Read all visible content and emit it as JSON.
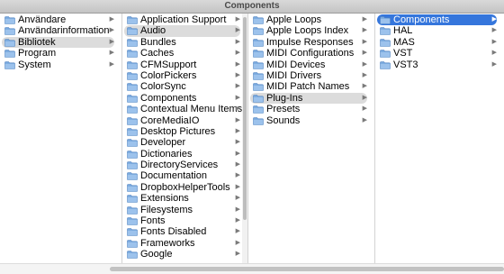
{
  "window": {
    "title": "Components"
  },
  "columns": [
    {
      "items": [
        {
          "label": "Användare",
          "selected": false
        },
        {
          "label": "Användarinformation",
          "selected": false
        },
        {
          "label": "Bibliotek",
          "selected": true
        },
        {
          "label": "Program",
          "selected": false
        },
        {
          "label": "System",
          "selected": false
        }
      ]
    },
    {
      "items": [
        {
          "label": "Application Support",
          "selected": false
        },
        {
          "label": "Audio",
          "selected": true
        },
        {
          "label": "Bundles",
          "selected": false
        },
        {
          "label": "Caches",
          "selected": false
        },
        {
          "label": "CFMSupport",
          "selected": false
        },
        {
          "label": "ColorPickers",
          "selected": false
        },
        {
          "label": "ColorSync",
          "selected": false
        },
        {
          "label": "Components",
          "selected": false
        },
        {
          "label": "Contextual Menu Items",
          "selected": false
        },
        {
          "label": "CoreMediaIO",
          "selected": false
        },
        {
          "label": "Desktop Pictures",
          "selected": false
        },
        {
          "label": "Developer",
          "selected": false
        },
        {
          "label": "Dictionaries",
          "selected": false
        },
        {
          "label": "DirectoryServices",
          "selected": false
        },
        {
          "label": "Documentation",
          "selected": false
        },
        {
          "label": "DropboxHelperTools",
          "selected": false
        },
        {
          "label": "Extensions",
          "selected": false
        },
        {
          "label": "Filesystems",
          "selected": false
        },
        {
          "label": "Fonts",
          "selected": false
        },
        {
          "label": "Fonts Disabled",
          "selected": false
        },
        {
          "label": "Frameworks",
          "selected": false
        },
        {
          "label": "Google",
          "selected": false
        }
      ]
    },
    {
      "items": [
        {
          "label": "Apple Loops",
          "selected": false
        },
        {
          "label": "Apple Loops Index",
          "selected": false
        },
        {
          "label": "Impulse Responses",
          "selected": false
        },
        {
          "label": "MIDI Configurations",
          "selected": false
        },
        {
          "label": "MIDI Devices",
          "selected": false
        },
        {
          "label": "MIDI Drivers",
          "selected": false
        },
        {
          "label": "MIDI Patch Names",
          "selected": false
        },
        {
          "label": "Plug-Ins",
          "selected": true
        },
        {
          "label": "Presets",
          "selected": false
        },
        {
          "label": "Sounds",
          "selected": false
        }
      ]
    },
    {
      "items": [
        {
          "label": "Components",
          "selected": true,
          "active": true
        },
        {
          "label": "HAL",
          "selected": false
        },
        {
          "label": "MAS",
          "selected": false
        },
        {
          "label": "VST",
          "selected": false
        },
        {
          "label": "VST3",
          "selected": false
        }
      ]
    }
  ],
  "icons": {
    "folder": "folder-icon",
    "disclosure": "chevron-right-icon"
  },
  "colors": {
    "selection_active": "#3576dc",
    "selection_inactive": "#dcdcdc",
    "folder": "#78a8de"
  }
}
